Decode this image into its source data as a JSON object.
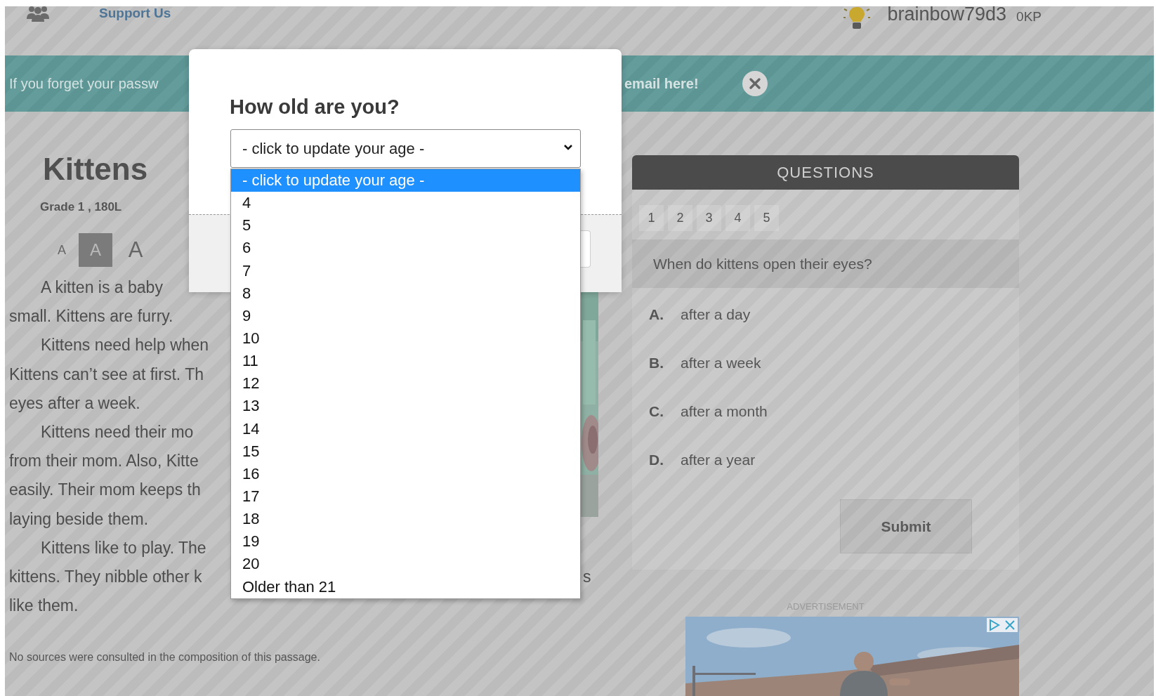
{
  "top_bar": {
    "support_link": "Support Us",
    "username": "brainbow79d3",
    "points": "0KP"
  },
  "banner": {
    "text_left": "If you forget your passw",
    "text_right": "email here!"
  },
  "article": {
    "title": "Kittens",
    "meta": "Grade 1 , 180L",
    "font_sizes": [
      {
        "label": "A",
        "kind": "small",
        "selected": false
      },
      {
        "label": "A",
        "kind": "medium",
        "selected": true
      },
      {
        "label": "A",
        "kind": "large",
        "selected": false
      }
    ],
    "paragraphs": [
      {
        "lines": [
          {
            "text": "A kitten is a baby"
          },
          {
            "text": "small. Kittens are furry."
          }
        ]
      },
      {
        "lines": [
          {
            "text": "Kittens need help when"
          },
          {
            "text": "Kittens can’t see at first. Th"
          },
          {
            "text": "eyes after a week."
          }
        ]
      },
      {
        "lines": [
          {
            "text": "Kittens need their mo"
          },
          {
            "text": "from their mom. Also, Kitte"
          },
          {
            "text": "easily. Their mom keeps th"
          },
          {
            "text": "laying beside them."
          }
        ]
      },
      {
        "lines": [
          {
            "text": "Kittens like to play. The"
          },
          {
            "text": "kittens. They nibble other k",
            "tail": "s"
          },
          {
            "text": "like them."
          }
        ]
      }
    ],
    "source_note": "No sources were consulted in the composition of this passage."
  },
  "questions": {
    "title": "QUESTIONS",
    "tabs": [
      {
        "label": "1",
        "selected": false
      },
      {
        "label": "2",
        "selected": false
      },
      {
        "label": "3",
        "selected": false
      },
      {
        "label": "4",
        "selected": false
      },
      {
        "label": "5",
        "selected": false
      }
    ],
    "prompt": "When do kittens open their eyes?",
    "options": [
      {
        "letter": "A.",
        "text": "after a day"
      },
      {
        "letter": "B.",
        "text": "after a week"
      },
      {
        "letter": "C.",
        "text": "after a month"
      },
      {
        "letter": "D.",
        "text": "after a year"
      }
    ],
    "submit": "Submit"
  },
  "advertisement": {
    "label": "ADVERTISEMENT"
  },
  "modal": {
    "title": "How old are you?",
    "select_value": "- click to update your age -",
    "options": [
      {
        "label": "- click to update your age -",
        "selected": true
      },
      {
        "label": "4",
        "selected": false
      },
      {
        "label": "5",
        "selected": false
      },
      {
        "label": "6",
        "selected": false
      },
      {
        "label": "7",
        "selected": false
      },
      {
        "label": "8",
        "selected": false
      },
      {
        "label": "9",
        "selected": false
      },
      {
        "label": "10",
        "selected": false
      },
      {
        "label": "11",
        "selected": false
      },
      {
        "label": "12",
        "selected": false
      },
      {
        "label": "13",
        "selected": false
      },
      {
        "label": "14",
        "selected": false
      },
      {
        "label": "15",
        "selected": false
      },
      {
        "label": "16",
        "selected": false
      },
      {
        "label": "17",
        "selected": false
      },
      {
        "label": "18",
        "selected": false
      },
      {
        "label": "19",
        "selected": false
      },
      {
        "label": "20",
        "selected": false
      },
      {
        "label": "Older than 21",
        "selected": false
      }
    ]
  }
}
